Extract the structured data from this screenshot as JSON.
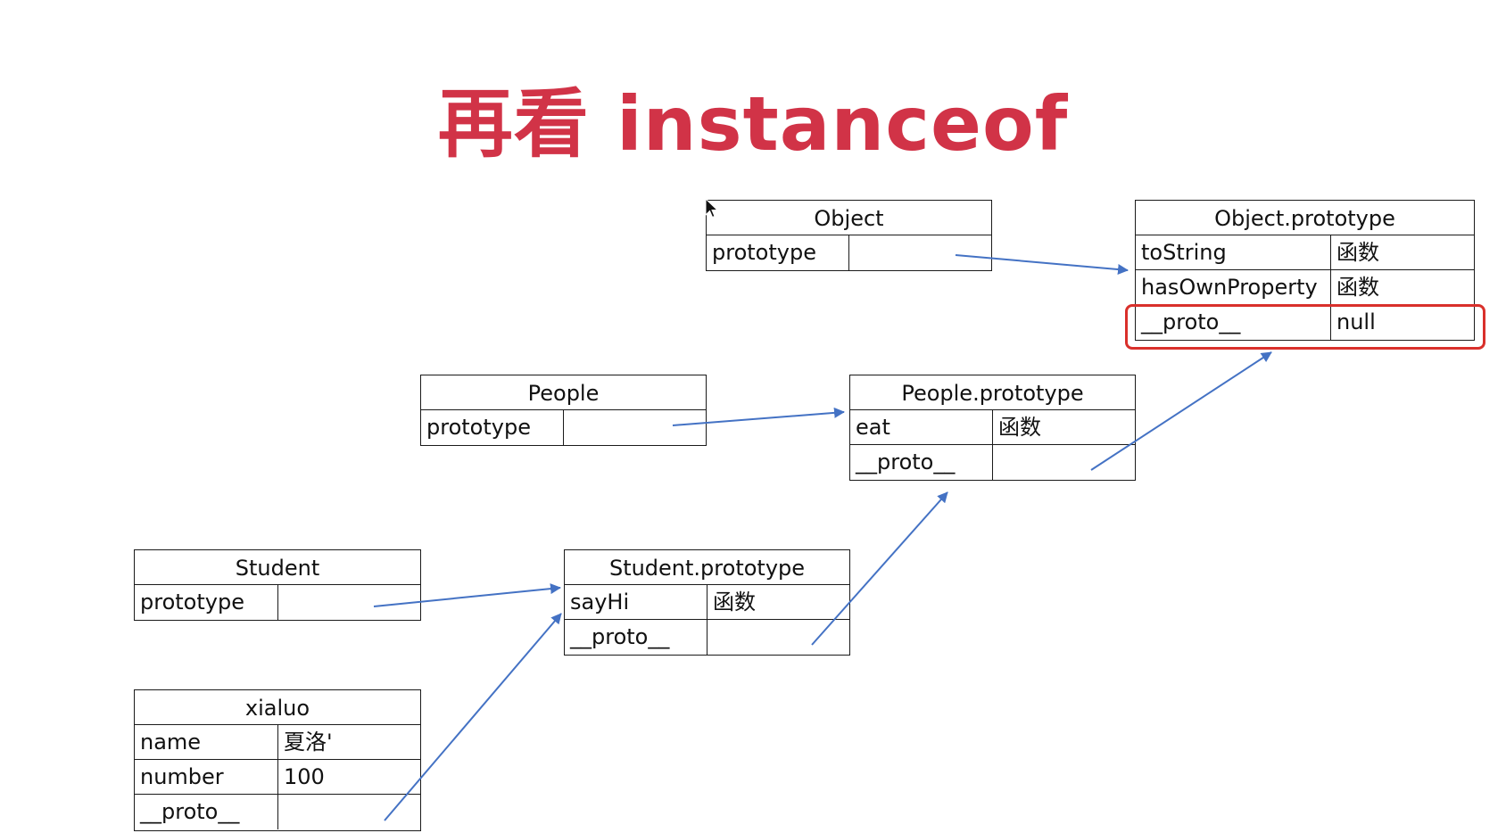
{
  "title": "再看 instanceof",
  "colors": {
    "title": "#d13347",
    "arrow": "#4472c4",
    "highlight": "#d9302b"
  },
  "boxes": {
    "object": {
      "header": "Object",
      "rows": [
        {
          "key": "prototype",
          "value": ""
        }
      ]
    },
    "object_prototype": {
      "header": "Object.prototype",
      "rows": [
        {
          "key": "toString",
          "value": "函数"
        },
        {
          "key": "hasOwnProperty",
          "value": "函数"
        },
        {
          "key": "__proto__",
          "value": "null"
        }
      ]
    },
    "people": {
      "header": "People",
      "rows": [
        {
          "key": "prototype",
          "value": ""
        }
      ]
    },
    "people_prototype": {
      "header": "People.prototype",
      "rows": [
        {
          "key": "eat",
          "value": "函数"
        },
        {
          "key": "__proto__",
          "value": ""
        }
      ]
    },
    "student": {
      "header": "Student",
      "rows": [
        {
          "key": "prototype",
          "value": ""
        }
      ]
    },
    "student_prototype": {
      "header": "Student.prototype",
      "rows": [
        {
          "key": "sayHi",
          "value": "函数"
        },
        {
          "key": "__proto__",
          "value": ""
        }
      ]
    },
    "xialuo": {
      "header": "xialuo",
      "rows": [
        {
          "key": "name",
          "value": "夏洛'"
        },
        {
          "key": "number",
          "value": "100"
        },
        {
          "key": "__proto__",
          "value": ""
        }
      ]
    }
  }
}
